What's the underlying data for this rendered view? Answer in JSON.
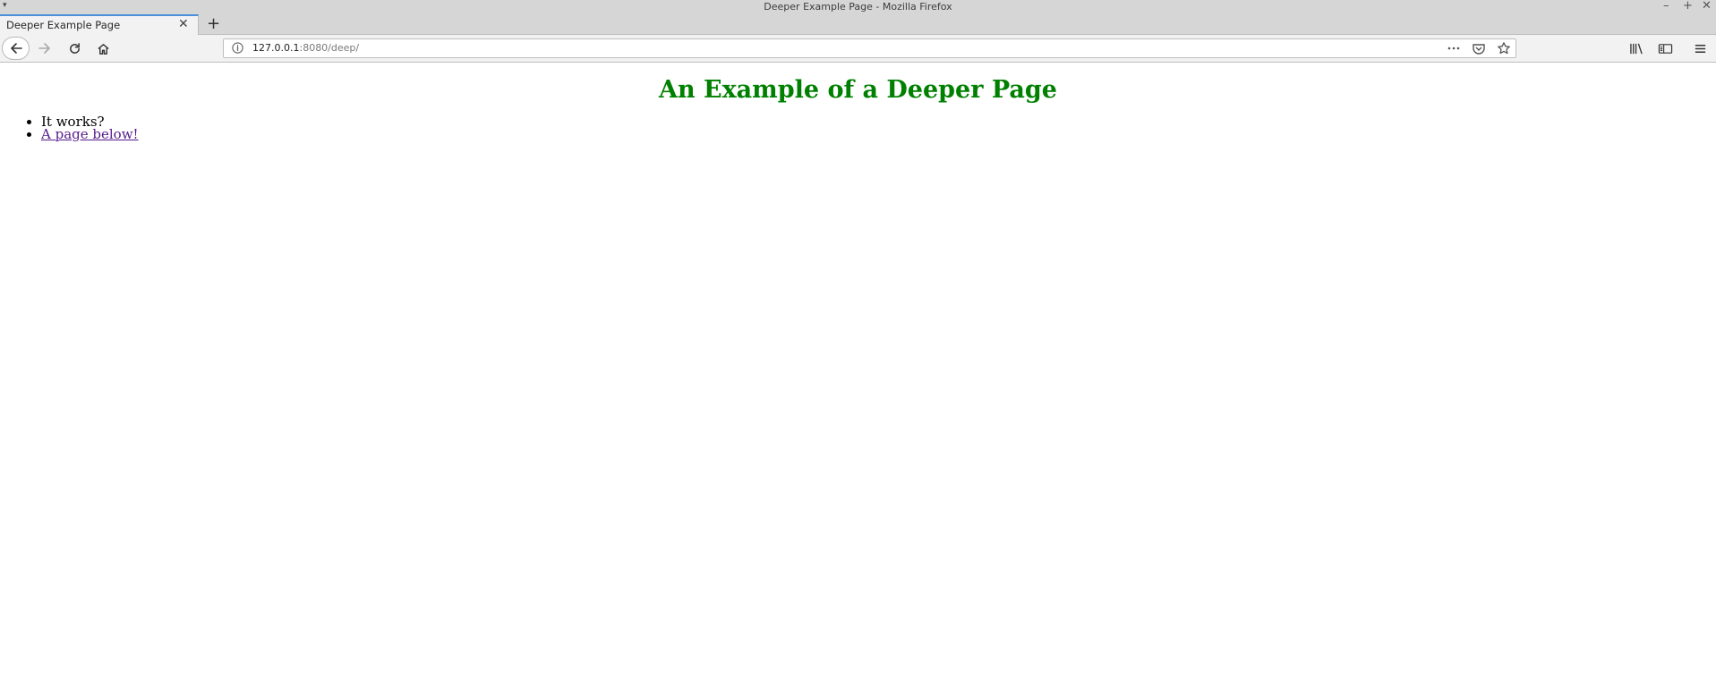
{
  "window": {
    "title": "Deeper Example Page - Mozilla Firefox"
  },
  "tabs": [
    {
      "label": "Deeper Example Page",
      "active": true
    }
  ],
  "urlbar": {
    "host": "127.0.0.1",
    "path": ":8080/deep/"
  },
  "page": {
    "heading": "An Example of a Deeper Page",
    "items": [
      {
        "text": "It works?",
        "link": false
      },
      {
        "text": "A page below!",
        "link": true
      }
    ]
  },
  "colors": {
    "heading": "#008000",
    "visited_link": "#551a8b",
    "tab_accent": "#4a90d9"
  },
  "icons": {
    "back": "arrow-left-icon",
    "forward": "arrow-right-icon",
    "reload": "reload-icon",
    "home": "home-icon",
    "info": "info-icon",
    "more": "more-icon",
    "pocket": "pocket-icon",
    "bookmark": "star-icon",
    "library": "library-icon",
    "sidebar": "sidebar-icon",
    "menu": "hamburger-menu-icon"
  }
}
